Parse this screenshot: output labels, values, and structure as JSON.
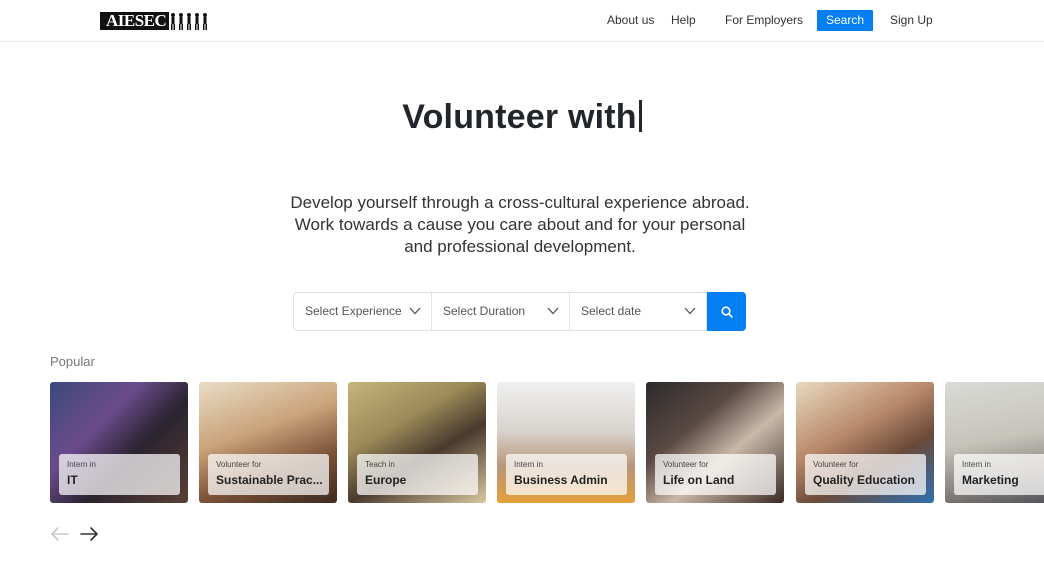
{
  "header": {
    "logo_text": "AIESEC",
    "nav": {
      "about": "About us",
      "help": "Help",
      "employers": "For Employers",
      "search": "Search",
      "signup": "Sign Up"
    }
  },
  "hero": {
    "title": "Volunteer with",
    "description_lines": [
      "Develop yourself through a cross-cultural experience abroad.",
      "Work towards a cause you care about and for your personal",
      "and professional development."
    ]
  },
  "search_bar": {
    "experience": "Select Experience",
    "duration": "Select Duration",
    "date": "Select date"
  },
  "popular": {
    "label": "Popular",
    "cards": [
      {
        "kicker": "Intern in",
        "category": "IT"
      },
      {
        "kicker": "Volunteer for",
        "category": "Sustainable Prac..."
      },
      {
        "kicker": "Teach in",
        "category": "Europe"
      },
      {
        "kicker": "Intern in",
        "category": "Business Admin"
      },
      {
        "kicker": "Volunteer for",
        "category": "Life on Land"
      },
      {
        "kicker": "Volunteer for",
        "category": "Quality Education"
      },
      {
        "kicker": "Intern in",
        "category": "Marketing"
      }
    ]
  },
  "colors": {
    "accent": "#037ef3",
    "title": "#22262a"
  }
}
